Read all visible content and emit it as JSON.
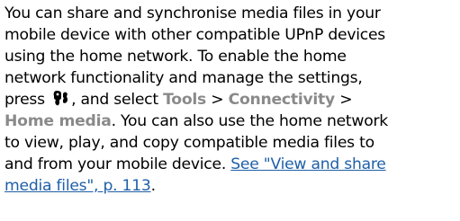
{
  "paragraph": {
    "line1": "You can share and synchronise media files in your",
    "line2": "mobile device with other compatible UPnP devices",
    "line3": "using the home network. To enable the home",
    "line4": "network functionality and manage the settings,",
    "line5_pre": "press",
    "line5_mid": ", and select",
    "menu_tools": "Tools",
    "sep1": ">",
    "menu_connectivity": "Connectivity",
    "sep2": ">",
    "menu_home_media": "Home media",
    "line6_post": ". You can also use the home network",
    "line7": "to view, play, and copy compatible media files to",
    "line8_pre": "and from your mobile device.",
    "link_part1": "See \"View and share",
    "link_part2": "media files\", p. 113",
    "line9_end": "."
  },
  "colors": {
    "text": "#000000",
    "menu": "#8a8a8a",
    "link": "#1f5fa8"
  },
  "icons": {
    "menu_key": "menu-key-icon"
  }
}
